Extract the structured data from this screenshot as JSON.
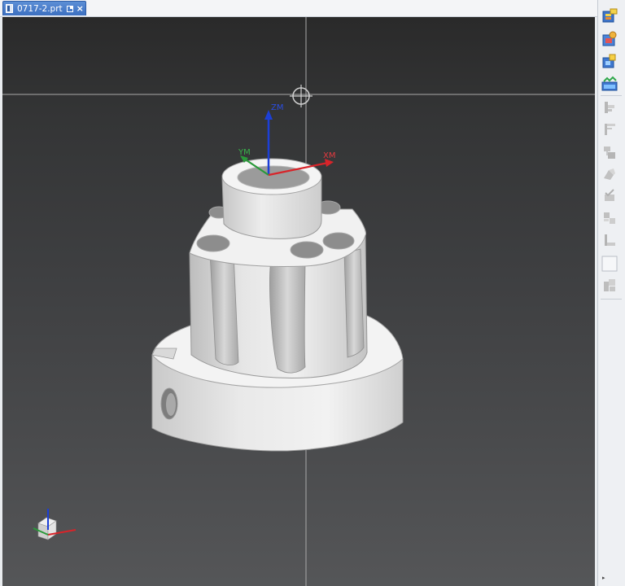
{
  "tab": {
    "title": "0717-2.prt",
    "float_icon": "restore-window-icon",
    "close_icon": "close-icon",
    "part_icon": "part-file-icon"
  },
  "viewport": {
    "background_top": "#2a2a2a",
    "background_bottom": "#555658",
    "crosshair_icon": "crosshair-target-icon",
    "part_color": "#e4e4e4",
    "wcs": {
      "z_label": "ZM",
      "y_label": "YM",
      "x_label": "XM",
      "z_color": "#1c3fd6",
      "y_color": "#2a9a3a",
      "x_color": "#d8242a"
    },
    "triad": {
      "cube_icon": "view-triad-cube-icon",
      "x_color": "#d8242a",
      "y_color": "#2a9a3a",
      "z_color": "#1c3fd6"
    }
  },
  "resource_bar": {
    "icons": [
      "assembly-navigator-icon",
      "constraint-navigator-icon",
      "part-navigator-icon",
      "reuse-library-icon",
      "operation-tool-icon-1",
      "operation-tool-icon-2",
      "operation-tool-icon-3",
      "operation-tool-icon-4",
      "operation-tool-icon-5",
      "operation-tool-icon-6",
      "operation-tool-icon-7",
      "blank-panel-icon",
      "operation-tool-icon-8"
    ],
    "scroll_arrow": "▸"
  }
}
